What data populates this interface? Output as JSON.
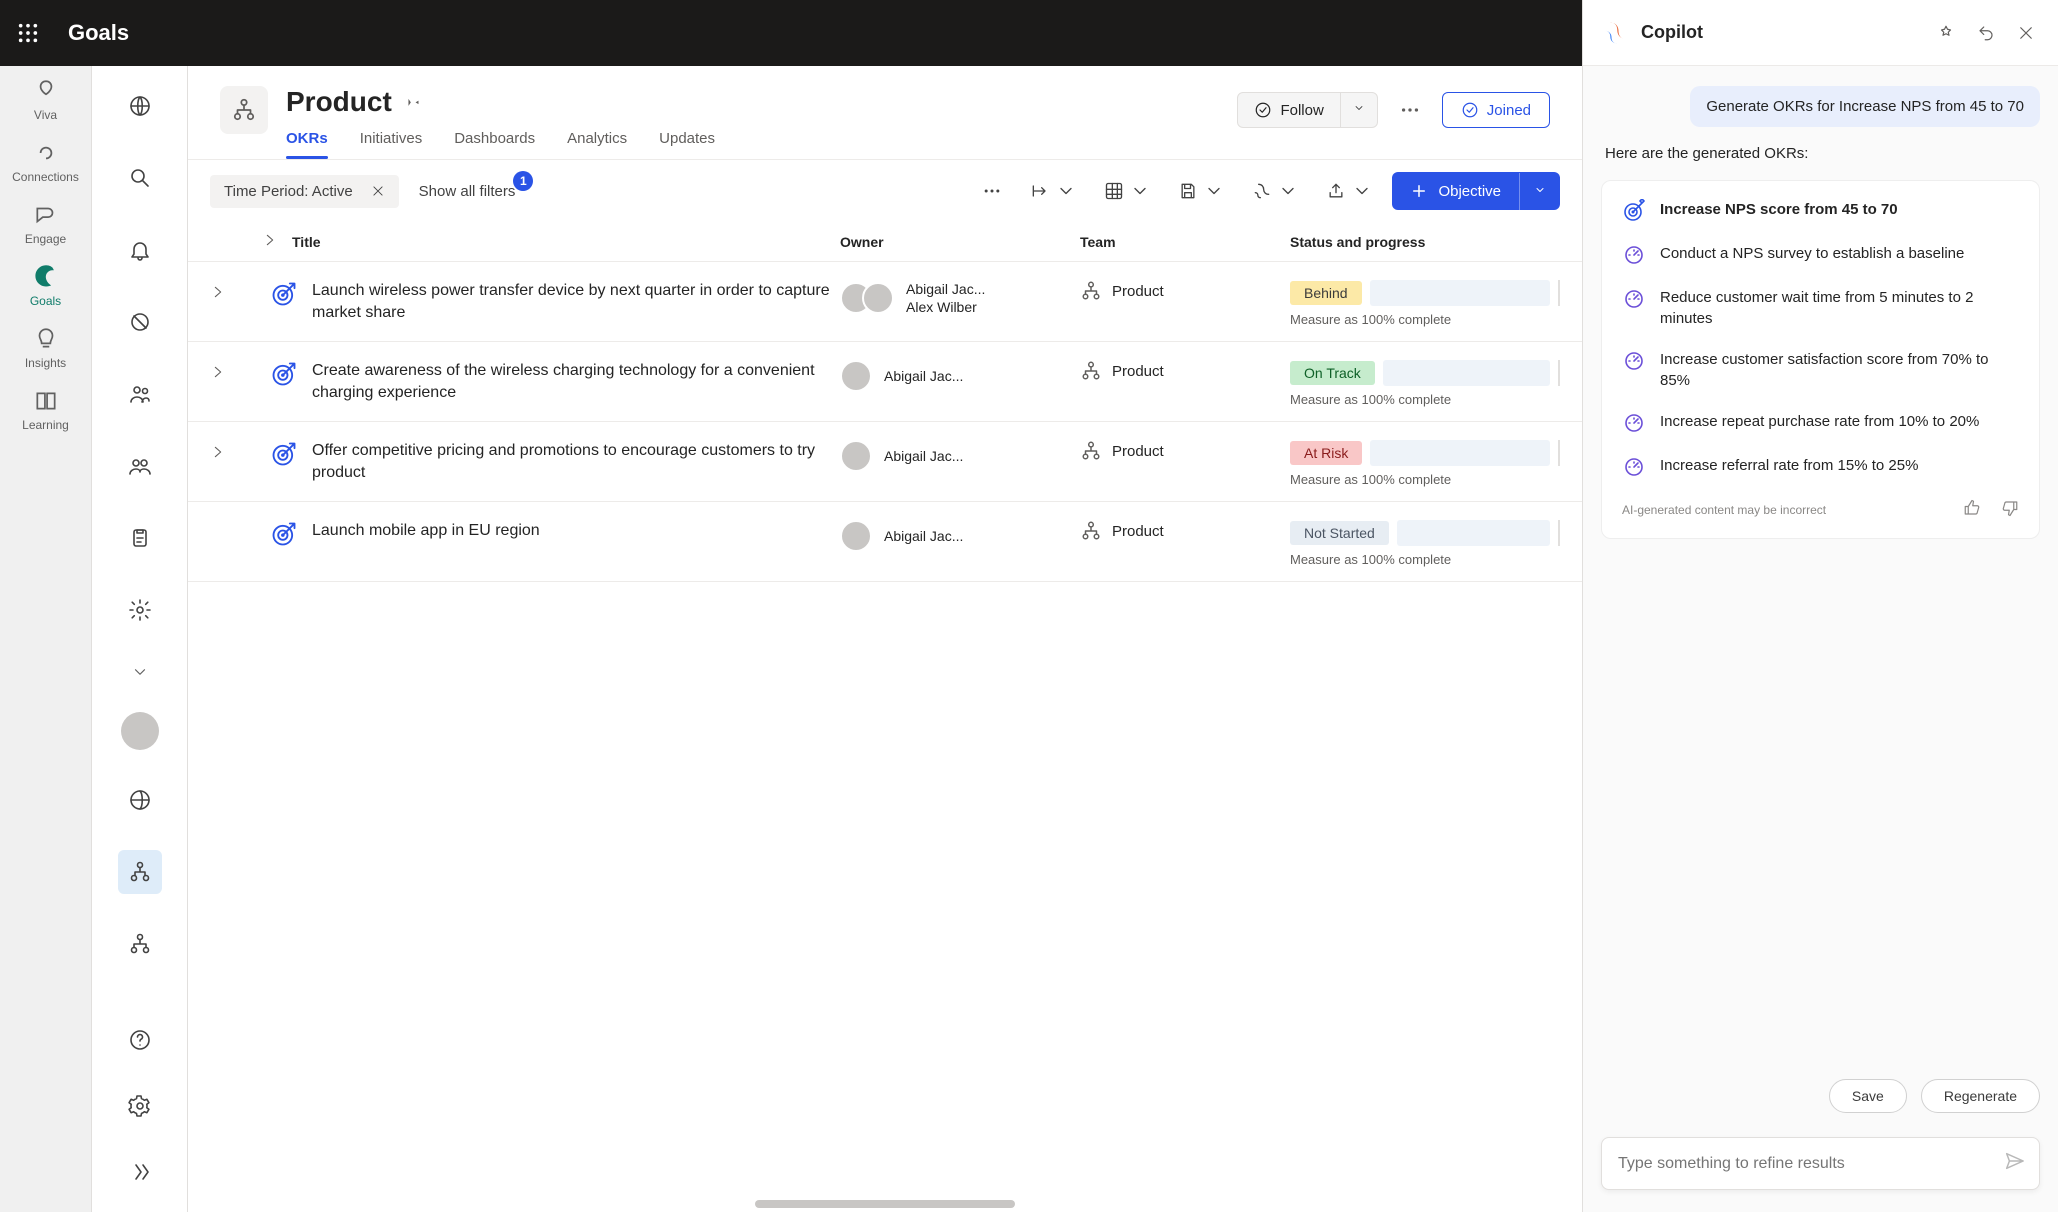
{
  "app": {
    "name": "Goals"
  },
  "apprail": {
    "items": [
      {
        "label": "Viva"
      },
      {
        "label": "Connections"
      },
      {
        "label": "Engage"
      },
      {
        "label": "Goals"
      },
      {
        "label": "Insights"
      },
      {
        "label": "Learning"
      }
    ]
  },
  "header": {
    "title": "Product",
    "tabs": [
      "OKRs",
      "Initiatives",
      "Dashboards",
      "Analytics",
      "Updates"
    ],
    "follow": "Follow",
    "joined": "Joined"
  },
  "toolbar": {
    "time_filter": "Time Period: Active",
    "show_filters": "Show all filters",
    "filter_badge": "1",
    "new_objective": "Objective"
  },
  "table": {
    "columns": {
      "title": "Title",
      "owner": "Owner",
      "team": "Team",
      "status": "Status and progress"
    },
    "rows": [
      {
        "title": "Launch wireless power transfer device by next quarter in order to capture market share",
        "owners": [
          "Abigail Jac...",
          "Alex Wilber"
        ],
        "team": "Product",
        "status_label": "Behind",
        "status_class": "behind",
        "measure": "Measure as 100% complete",
        "expandable": true
      },
      {
        "title": "Create awareness of the wireless charging technology for a convenient charging experience",
        "owners": [
          "Abigail Jac..."
        ],
        "team": "Product",
        "status_label": "On Track",
        "status_class": "ontrack",
        "measure": "Measure as 100% complete",
        "expandable": true
      },
      {
        "title": "Offer competitive pricing and promotions to encourage customers to try product",
        "owners": [
          "Abigail Jac..."
        ],
        "team": "Product",
        "status_label": "At Risk",
        "status_class": "atrisk",
        "measure": "Measure as 100% complete",
        "expandable": true
      },
      {
        "title": "Launch mobile app in EU region",
        "owners": [
          "Abigail Jac..."
        ],
        "team": "Product",
        "status_label": "Not Started",
        "status_class": "notstarted",
        "measure": "Measure as 100% complete",
        "expandable": false
      }
    ]
  },
  "copilot": {
    "title": "Copilot",
    "user_msg": "Generate OKRs for Increase NPS from 45 to 70",
    "intro": "Here are the generated OKRs:",
    "okrs": {
      "objective": "Increase NPS score from 45 to 70",
      "krs": [
        "Conduct a NPS survey to establish a baseline",
        "Reduce customer wait time from 5 minutes to 2 minutes",
        "Increase customer satisfaction score from 70% to 85%",
        "Increase repeat purchase rate from 10% to 20%",
        "Increase referral rate from 15% to 25%"
      ]
    },
    "disclaimer": "AI-generated content may be incorrect",
    "save": "Save",
    "regenerate": "Regenerate",
    "placeholder": "Type something to refine results"
  }
}
